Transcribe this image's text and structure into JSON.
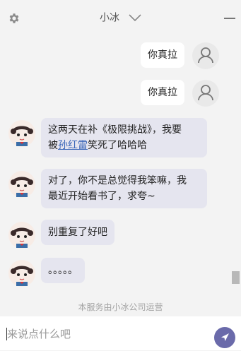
{
  "header": {
    "title": "小冰",
    "settings_icon": "gear-icon",
    "dropdown_icon": "chevron-down-icon",
    "minimize_icon": "minimize-icon"
  },
  "messages": [
    {
      "sender": "user",
      "text": "你真拉"
    },
    {
      "sender": "user",
      "text": "你真拉"
    },
    {
      "sender": "bot",
      "line1": "这两天在补《极限挑战》，我要",
      "line2_pre": "被",
      "link": "孙红雷",
      "line2_post": "笑死了哈哈哈"
    },
    {
      "sender": "bot",
      "line1": "对了，你不是总觉得我笨嘛，我",
      "line2": "最近开始看书了，求夸~"
    },
    {
      "sender": "bot",
      "text": "别重复了好吧"
    },
    {
      "sender": "bot",
      "text": "。。。。。"
    }
  ],
  "footer_note": "本服务由小冰公司运营",
  "input": {
    "placeholder": "来说点什么吧",
    "value": ""
  },
  "send_icon": "send-icon",
  "colors": {
    "background": "#f3f3f3",
    "bot_bubble": "#e5e5ef",
    "user_bubble": "#ffffff",
    "send_button": "#6a6aaa",
    "link": "#3a66b8"
  }
}
